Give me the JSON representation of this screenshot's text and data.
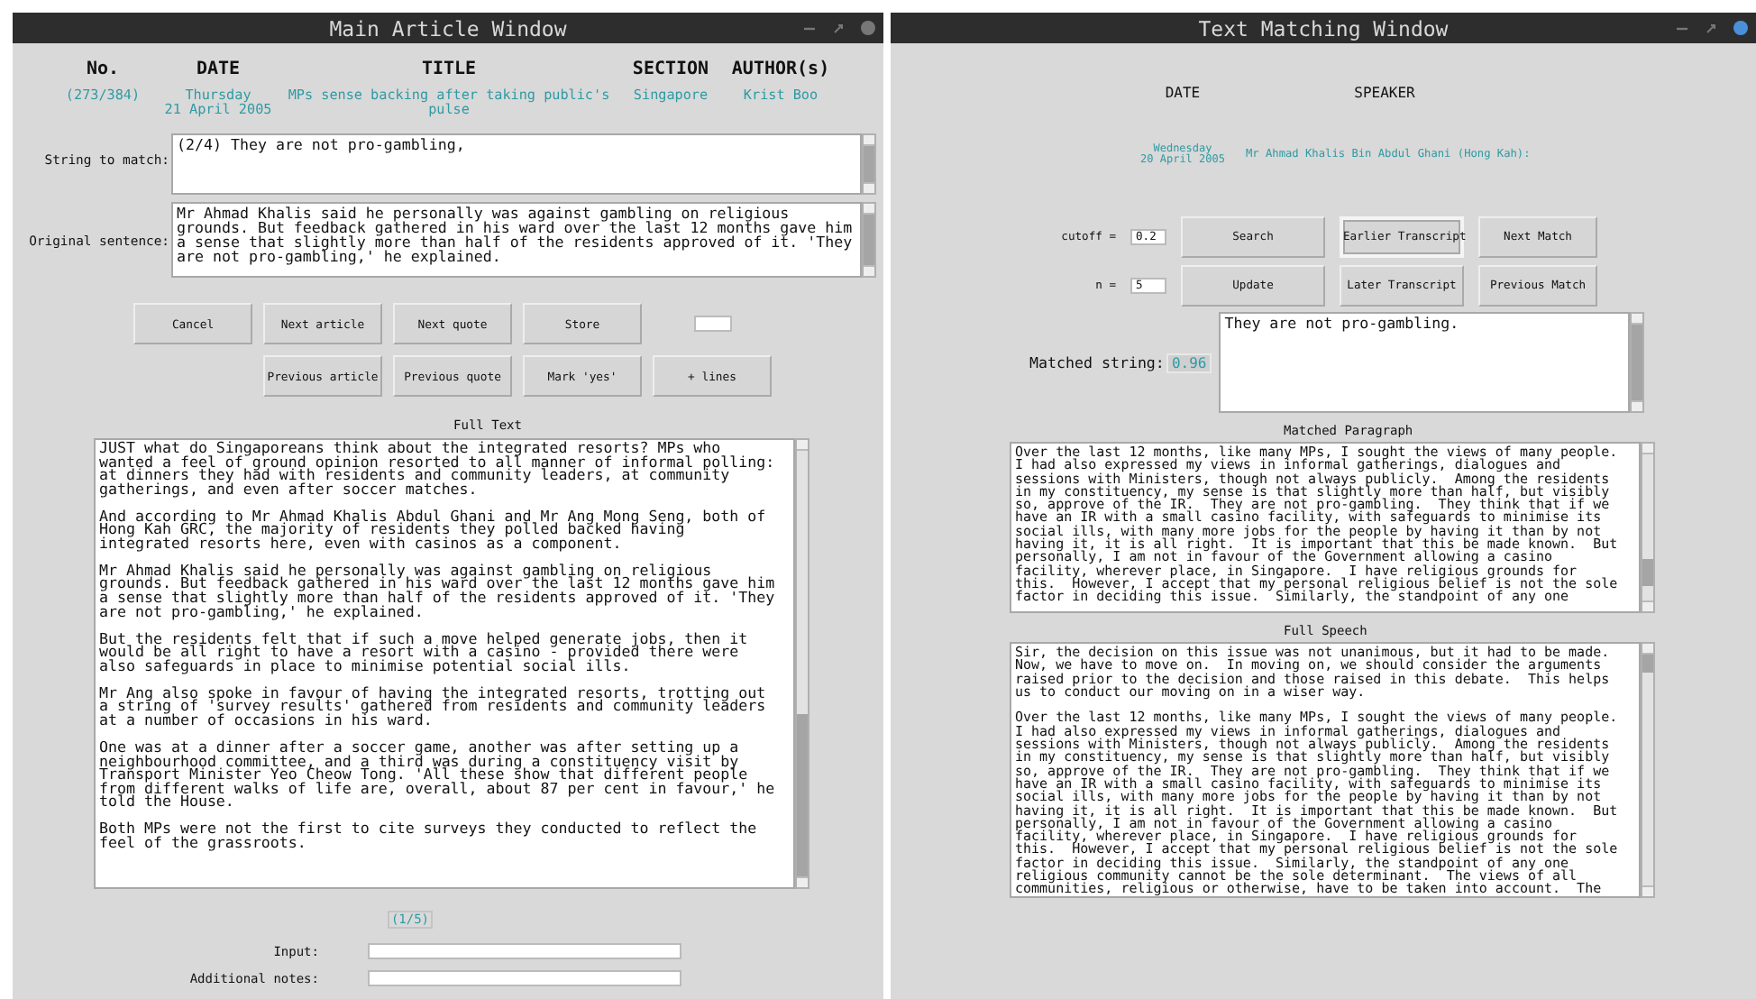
{
  "main_window": {
    "title": "Main Article Window",
    "header": [
      {
        "heading": "No.",
        "value_lines": [
          "(273/384)"
        ]
      },
      {
        "heading": "DATE",
        "value_lines": [
          "Thursday",
          "21 April 2005"
        ]
      },
      {
        "heading": "TITLE",
        "value_lines": [
          "MPs sense backing after taking public's",
          "pulse"
        ]
      },
      {
        "heading": "SECTION",
        "value_lines": [
          "Singapore"
        ]
      },
      {
        "heading": "AUTHOR(s)",
        "value_lines": [
          "Krist Boo"
        ]
      }
    ],
    "string_to_match": {
      "label": "String to match:",
      "value": "(2/4) They are not pro-gambling,"
    },
    "original_sentence": {
      "label": "Original sentence:",
      "lines": [
        "Mr Ahmad Khalis said he personally was against gambling on religious",
        "grounds. But feedback gathered in his ward over the last 12 months gave him",
        "a sense that slightly more than half of the residents approved of it. 'They",
        "are not pro-gambling,' he explained."
      ]
    },
    "button_rows": [
      [
        "Cancel",
        "Next article",
        "Next quote",
        "Store"
      ],
      [
        "Previous article",
        "Previous quote",
        "Mark 'yes'",
        "+ lines"
      ]
    ],
    "full_text": {
      "label": "Full Text",
      "paragraphs": [
        [
          "JUST what do Singaporeans think about the integrated resorts? MPs who",
          "wanted a feel of ground opinion resorted to all manner of informal polling:",
          "at dinners they had with residents and community leaders, at community",
          "gatherings, and even after soccer matches."
        ],
        [
          "And according to Mr Ahmad Khalis Abdul Ghani and Mr Ang Mong Seng, both of",
          "Hong Kah GRC, the majority of residents they polled backed having",
          "integrated resorts here, even with casinos as a component."
        ],
        [
          "Mr Ahmad Khalis said he personally was against gambling on religious",
          "grounds. But feedback gathered in his ward over the last 12 months gave him",
          "a sense that slightly more than half of the residents approved of it. 'They",
          "are not pro-gambling,' he explained."
        ],
        [
          "But the residents felt that if such a move helped generate jobs, then it",
          "would be all right to have a resort with a casino - provided there were",
          "also safeguards in place to minimise potential social ills."
        ],
        [
          "Mr Ang also spoke in favour of having the integrated resorts, trotting out",
          "a string of 'survey results' gathered from residents and community leaders",
          "at a number of occasions in his ward."
        ],
        [
          "One was at a dinner after a soccer game, another was after setting up a",
          "neighbourhood committee, and a third was during a constituency visit by",
          "Transport Minister Yeo Cheow Tong. 'All these show that different people",
          "from different walks of life are, overall, about 87 per cent in favour,' he",
          "told the House."
        ],
        [
          "Both MPs were not the first to cite surveys they conducted to reflect the",
          "feel of the grassroots."
        ]
      ]
    },
    "page_indicator": "(1/5)",
    "form_fields": [
      {
        "label": "Input:"
      },
      {
        "label": "Additional notes:"
      }
    ]
  },
  "matching_window": {
    "title": "Text Matching Window",
    "headings": [
      "DATE",
      "SPEAKER"
    ],
    "date_lines": [
      "Wednesday",
      "20 April 2005"
    ],
    "speaker": "Mr Ahmad Khalis Bin Abdul Ghani (Hong Kah):",
    "parameters": [
      {
        "label": "cutoff =",
        "value": "0.2"
      },
      {
        "label": "n =",
        "value": "5"
      }
    ],
    "button_rows": [
      [
        {
          "label": "Search",
          "focused": false
        },
        {
          "label": "Earlier Transcript",
          "focused": true
        },
        {
          "label": "Next Match",
          "focused": false
        }
      ],
      [
        {
          "label": "Update",
          "focused": false
        },
        {
          "label": "Later Transcript",
          "focused": false
        },
        {
          "label": "Previous Match",
          "focused": false
        }
      ]
    ],
    "matched_string": {
      "label": "Matched string:",
      "score": "0.96",
      "value": "They are not pro-gambling."
    },
    "matched_paragraph": {
      "label": "Matched Paragraph",
      "lines": [
        "Over the last 12 months, like many MPs, I sought the views of many people.",
        "I had also expressed my views in informal gatherings, dialogues and",
        "sessions with Ministers, though not always publicly.  Among the residents",
        "in my constituency, my sense is that slightly more than half, but visibly",
        "so, approve of the IR.  They are not pro-gambling.  They think that if we",
        "have an IR with a small casino facility, with safeguards to minimise its",
        "social ills, with many more jobs for the people by having it than by not",
        "having it, it is all right.  It is important that this be made known.  But",
        "personally, I am not in favour of the Government allowing a casino",
        "facility, wherever place, in Singapore.  I have religious grounds for",
        "this.  However, I accept that my personal religious belief is not the sole",
        "factor in deciding this issue.  Similarly, the standpoint of any one"
      ]
    },
    "full_speech": {
      "label": "Full Speech",
      "paragraphs": [
        [
          "Sir, the decision on this issue was not unanimous, but it had to be made.",
          "Now, we have to move on.  In moving on, we should consider the arguments",
          "raised prior to the decision and those raised in this debate.  This helps",
          "us to conduct our moving on in a wiser way."
        ],
        [
          "Over the last 12 months, like many MPs, I sought the views of many people.",
          "I had also expressed my views in informal gatherings, dialogues and",
          "sessions with Ministers, though not always publicly.  Among the residents",
          "in my constituency, my sense is that slightly more than half, but visibly",
          "so, approve of the IR.  They are not pro-gambling.  They think that if we",
          "have an IR with a small casino facility, with safeguards to minimise its",
          "social ills, with many more jobs for the people by having it than by not",
          "having it, it is all right.  It is important that this be made known.  But",
          "personally, I am not in favour of the Government allowing a casino",
          "facility, wherever place, in Singapore.  I have religious grounds for",
          "this.  However, I accept that my personal religious belief is not the sole",
          "factor in deciding this issue.  Similarly, the standpoint of any one",
          "religious community cannot be the sole determinant.  The views of all",
          "communities, religious or otherwise, have to be taken into account.  The"
        ]
      ]
    }
  }
}
